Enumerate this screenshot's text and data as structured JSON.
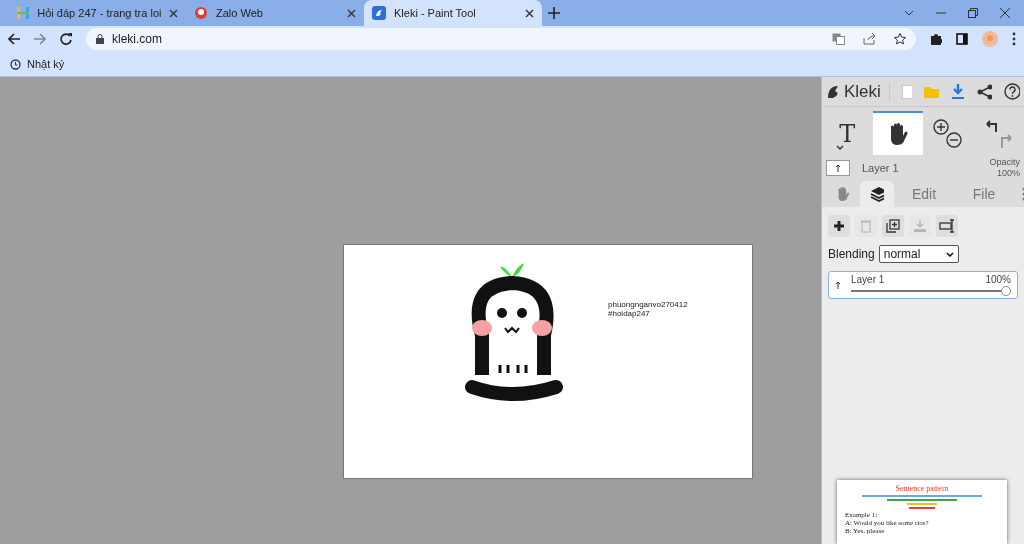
{
  "browser": {
    "tabs": [
      {
        "title": "Hỏi đáp 247 - trang tra loi",
        "kind": "hoidap",
        "selected": false
      },
      {
        "title": "Zalo Web",
        "kind": "zalo",
        "selected": false
      },
      {
        "title": "Kleki - Paint Tool",
        "kind": "kleki",
        "selected": true
      }
    ],
    "address": "kleki.com",
    "bookmarks": [
      {
        "label": "Nhật ký"
      }
    ]
  },
  "canvas": {
    "text_lines": [
      "phuongnganvo270412",
      "#hoidap247"
    ]
  },
  "sidebar": {
    "logo": "Kleki",
    "tools": [
      {
        "kind": "text",
        "label": "T",
        "selected": false
      },
      {
        "kind": "hand",
        "selected": true
      },
      {
        "kind": "zoom",
        "selected": false
      },
      {
        "kind": "history",
        "selected": false
      }
    ],
    "current_layer": {
      "name": "Layer 1",
      "opacity_label": "Opacity",
      "opacity": "100%"
    },
    "panel_tabs": [
      {
        "kind": "hand",
        "selected": false
      },
      {
        "kind": "layers",
        "selected": true
      },
      {
        "kind": "text",
        "label": "Edit",
        "selected": false
      },
      {
        "kind": "text",
        "label": "File",
        "selected": false
      }
    ],
    "layer_buttons": [
      {
        "kind": "add",
        "disabled": false
      },
      {
        "kind": "delete",
        "disabled": true
      },
      {
        "kind": "duplicate",
        "disabled": false
      },
      {
        "kind": "merge",
        "disabled": true
      },
      {
        "kind": "rename",
        "disabled": false
      }
    ],
    "blending": {
      "label": "Blending",
      "value": "normal"
    },
    "layers": [
      {
        "name": "Layer 1",
        "opacity": "100%",
        "level": 1.0,
        "selected": true
      }
    ]
  },
  "preview": {
    "title": "Sentence pattern",
    "lines": [
      "Example 1:",
      "A: Would you like some rice?",
      "B: Yes, please"
    ]
  }
}
